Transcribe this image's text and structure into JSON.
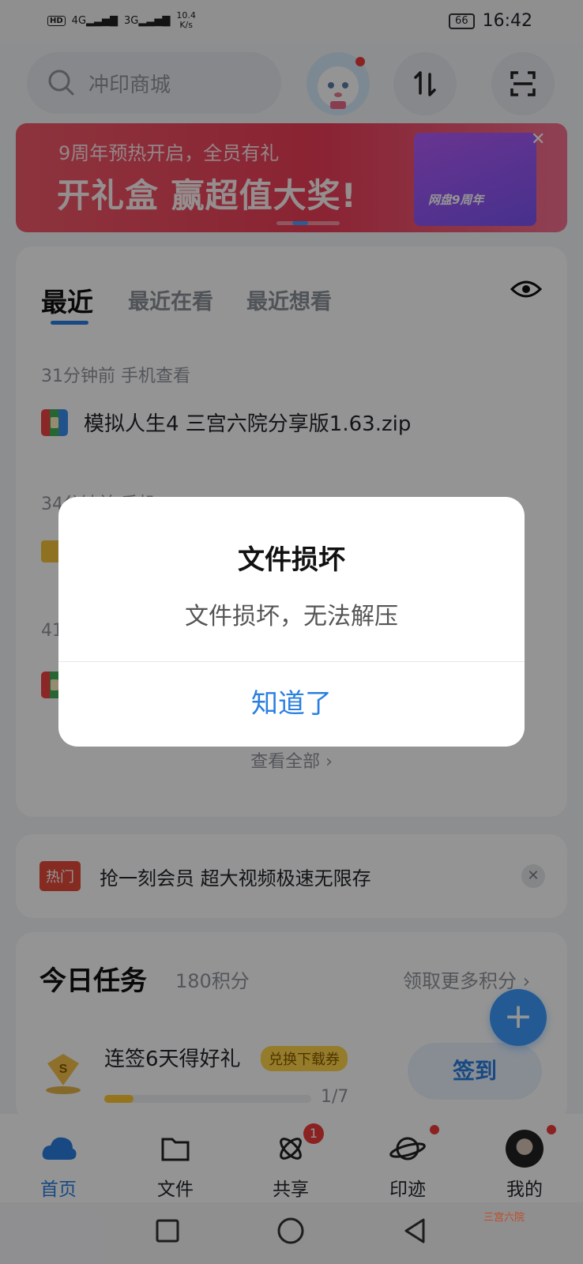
{
  "status_bar": {
    "network_hd": "HD",
    "net1": "4G",
    "net2": "3G",
    "speed": "10.4",
    "speed_unit": "K/s",
    "battery": "66",
    "time": "16:42"
  },
  "header": {
    "search_placeholder": "冲印商城"
  },
  "banner": {
    "subtitle": "9周年预热开启，全员有礼",
    "title": "开礼盒 赢超值大奖!",
    "box_label": "网盘9周年"
  },
  "recent": {
    "tabs": [
      "最近",
      "最近在看",
      "最近想看"
    ],
    "groups": [
      {
        "meta": "31分钟前  手机查看",
        "file": "模拟人生4 三宫六院分享版1.63.zip"
      },
      {
        "meta": "34分钟前  手机..."
      },
      {
        "meta": "41"
      }
    ],
    "view_all": "查看全部"
  },
  "notice": {
    "tag": "热门",
    "text": "抢一刻会员 超大视频极速无限存"
  },
  "tasks": {
    "title": "今日任务",
    "points": "180积分",
    "more": "领取更多积分",
    "item": {
      "label": "连签6天得好礼",
      "badge": "兑换下载券",
      "progress_text": "1/7",
      "progress": 0.14,
      "button": "签到"
    }
  },
  "nav": {
    "items": [
      "首页",
      "文件",
      "共享",
      "印迹",
      "我的"
    ],
    "share_badge": "1"
  },
  "dialog": {
    "title": "文件损坏",
    "message": "文件损坏，无法解压",
    "button": "知道了"
  },
  "watermark": "三宫六院",
  "colors": {
    "accent": "#2a7fe0",
    "banner": "#ee3d58",
    "hot": "#e54a3c"
  }
}
